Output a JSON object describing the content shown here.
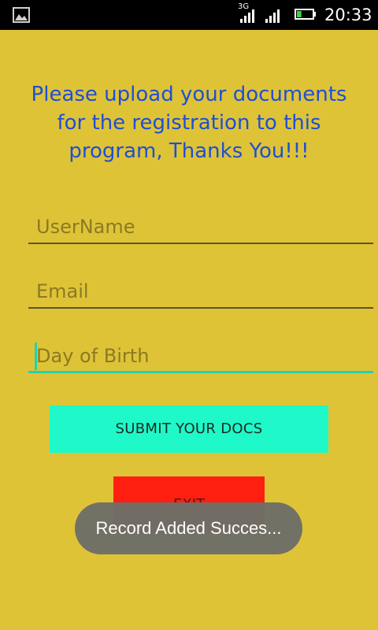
{
  "status_bar": {
    "network": "3G",
    "time": "20:33",
    "battery_level": 0.3
  },
  "form": {
    "heading": "Please upload your documents for the registration to this program, Thanks You!!!",
    "username_hint": "UserName",
    "email_hint": "Email",
    "dob_hint": "Day of Birth",
    "submit_label": "SUBMIT YOUR DOCS",
    "exit_label": "EXIT"
  },
  "toast": {
    "message": "Record Added Succes..."
  },
  "colors": {
    "background": "#dfc337",
    "heading": "#1f4fd3",
    "accent": "#1ff8c8",
    "exit": "#ff1f10"
  }
}
